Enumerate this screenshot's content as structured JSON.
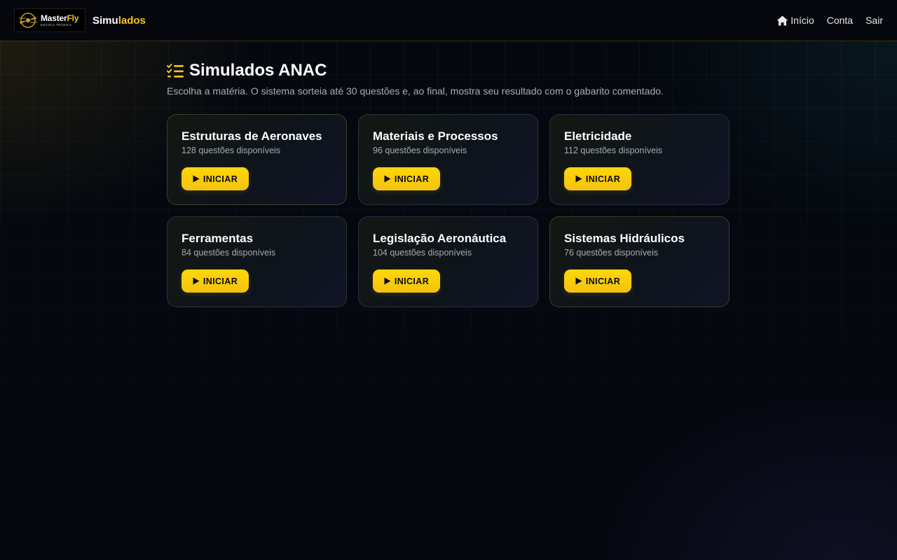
{
  "header": {
    "logo": {
      "name_part1": "Master",
      "name_part2": "Fly",
      "subtitle": "ESCOLA TÉCNICA"
    },
    "title_part1": "Simu",
    "title_part2": "lados",
    "nav": [
      {
        "label": "Início",
        "icon": "home-icon"
      },
      {
        "label": "Conta"
      },
      {
        "label": "Sair"
      }
    ]
  },
  "main": {
    "title": "Simulados ANAC",
    "title_icon": "checklist-icon",
    "subtitle": "Escolha a matéria. O sistema sorteia até 30 questões e, ao final, mostra seu resultado com o gabarito comentado.",
    "cards": [
      {
        "title": "Estruturas de Aeronaves",
        "count": "128 questões disponíveis",
        "button": "INICIAR"
      },
      {
        "title": "Materiais e Processos",
        "count": "96 questões disponíveis",
        "button": "INICIAR"
      },
      {
        "title": "Eletricidade",
        "count": "112 questões disponíveis",
        "button": "INICIAR"
      },
      {
        "title": "Ferramentas",
        "count": "84 questões disponíveis",
        "button": "INICIAR"
      },
      {
        "title": "Legislação Aeronáutica",
        "count": "104 questões disponíveis",
        "button": "INICIAR"
      },
      {
        "title": "Sistemas Hidráulicos",
        "count": "76 questões disponíveis",
        "button": "INICIAR"
      }
    ]
  },
  "colors": {
    "accent": "#f5c518",
    "background": "#05080f",
    "text_muted": "#a9adb5"
  }
}
